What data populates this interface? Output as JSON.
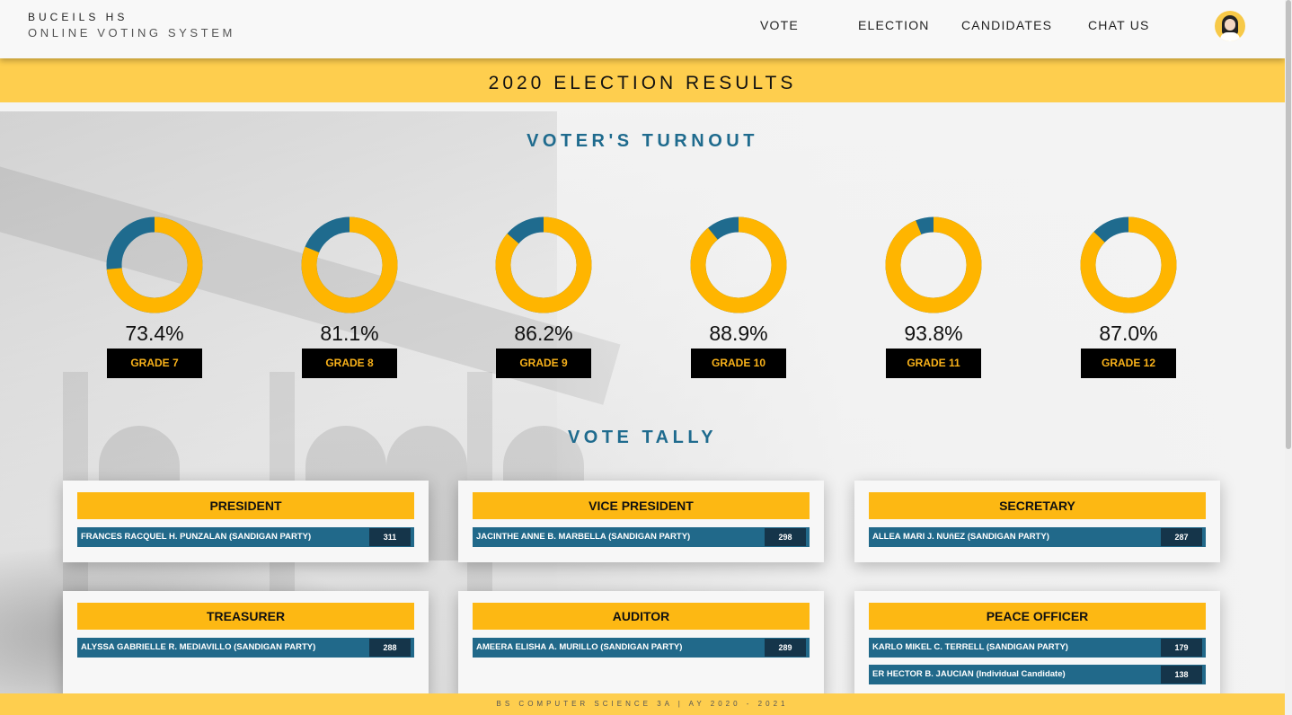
{
  "brand": {
    "name": "BUCEILS HS",
    "subtitle": "ONLINE VOTING SYSTEM"
  },
  "nav": {
    "items": [
      "VOTE",
      "ELECTION",
      "CANDIDATES",
      "CHAT US"
    ]
  },
  "avatar_icon": "user-avatar-icon",
  "results_title": "2020 ELECTION RESULTS",
  "turnout": {
    "title": "VOTER'S TURNOUT",
    "colors": {
      "filled": "#ffb500",
      "remaining": "#1f6b8e"
    },
    "grades": [
      {
        "label": "GRADE 7",
        "percent_text": "73.4%",
        "value": 73.4
      },
      {
        "label": "GRADE 8",
        "percent_text": "81.1%",
        "value": 81.1
      },
      {
        "label": "GRADE 9",
        "percent_text": "86.2%",
        "value": 86.2
      },
      {
        "label": "GRADE 10",
        "percent_text": "88.9%",
        "value": 88.9
      },
      {
        "label": "GRADE 11",
        "percent_text": "93.8%",
        "value": 93.8
      },
      {
        "label": "GRADE 12",
        "percent_text": "87.0%",
        "value": 87.0
      }
    ]
  },
  "tally": {
    "title": "VOTE TALLY",
    "positions": [
      {
        "title": "PRESIDENT",
        "candidates": [
          {
            "name": "FRANCES RACQUEL H. PUNZALAN (SANDIGAN PARTY)",
            "votes": "311"
          }
        ]
      },
      {
        "title": "VICE PRESIDENT",
        "candidates": [
          {
            "name": "JACINTHE ANNE B. MARBELLA (SANDIGAN PARTY)",
            "votes": "298"
          }
        ]
      },
      {
        "title": "SECRETARY",
        "candidates": [
          {
            "name": "ALLEA MARI J. NUñEZ (SANDIGAN PARTY)",
            "votes": "287"
          }
        ]
      },
      {
        "title": "TREASURER",
        "candidates": [
          {
            "name": "ALYSSA GABRIELLE R. MEDIAVILLO (SANDIGAN PARTY)",
            "votes": "288"
          }
        ]
      },
      {
        "title": "AUDITOR",
        "candidates": [
          {
            "name": "AMEERA ELISHA A. MURILLO (SANDIGAN PARTY)",
            "votes": "289"
          }
        ]
      },
      {
        "title": "PEACE OFFICER",
        "candidates": [
          {
            "name": "KARLO MIKEL C. TERRELL (SANDIGAN PARTY)",
            "votes": "179"
          },
          {
            "name": "ER HECTOR B. JAUCIAN (Individual Candidate)",
            "votes": "138"
          }
        ]
      }
    ]
  },
  "footer": "BS COMPUTER SCIENCE 3A | AY 2020 - 2021"
}
